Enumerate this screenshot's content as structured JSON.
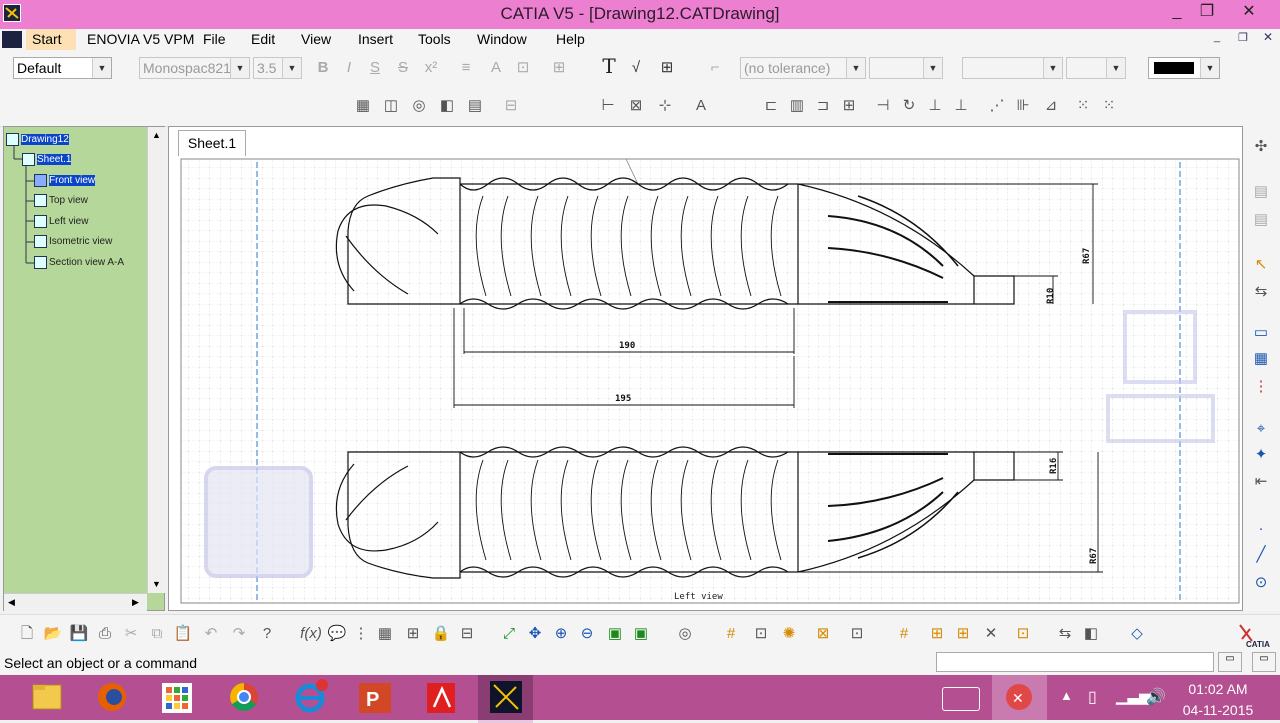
{
  "window": {
    "title": "CATIA V5 - [Drawing12.CATDrawing]",
    "minimize": "_",
    "restore": "❐",
    "close": "✕"
  },
  "menu": {
    "start": "Start",
    "items": [
      "ENOVIA V5 VPM",
      "File",
      "Edit",
      "View",
      "Insert",
      "Tools",
      "Window",
      "Help"
    ]
  },
  "toolbar": {
    "style_value": "Default",
    "font_value": "Monospac821",
    "size_value": "3.5",
    "tolerance_value": "(no tolerance)",
    "color_swatch": "#000000"
  },
  "tree": {
    "root": "Drawing12",
    "sheet": "Sheet.1",
    "views": [
      "Front view",
      "Top view",
      "Left view",
      "Isometric view",
      "Section view A-A"
    ]
  },
  "sheet_tab": "Sheet.1",
  "drawing": {
    "dims": {
      "r67_top": "R67",
      "r10": "R10",
      "d190": "190",
      "d195": "195",
      "r16": "R16",
      "r67_bottom": "R67"
    },
    "view_caption": "Left view"
  },
  "status": {
    "prompt": "Select an object or a command"
  },
  "taskbar": {
    "apps": [
      "file-explorer",
      "firefox",
      "apps-grid",
      "chrome",
      "ie",
      "powerpoint",
      "acrobat",
      "catia"
    ],
    "time": "01:02 AM",
    "date": "04-11-2015"
  },
  "colors": {
    "titlebar": "#ed7fd1",
    "taskbar": "#b44f91",
    "tree_bg": "#b5d89a",
    "selection": "#0c46c8"
  }
}
